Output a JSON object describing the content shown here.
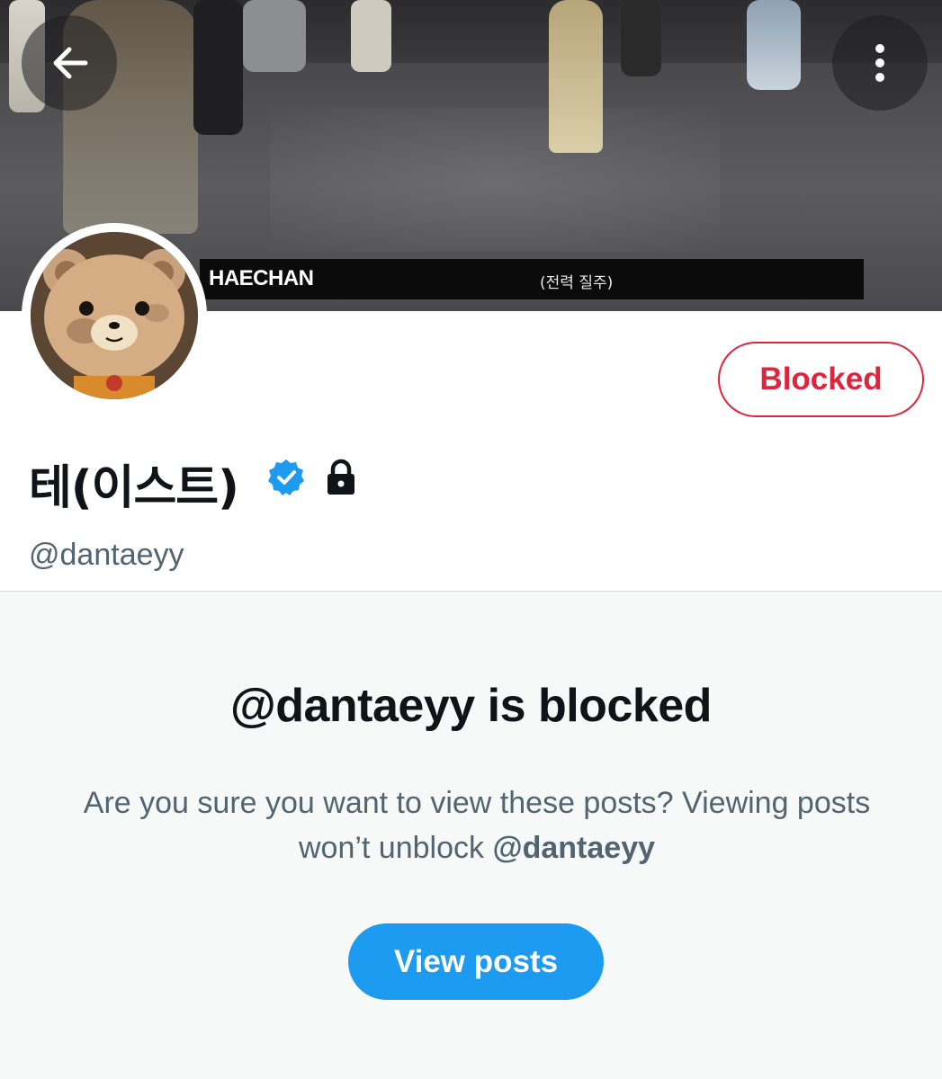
{
  "header": {
    "back_icon": "arrow-left-icon",
    "more_icon": "vertical-dots-icon",
    "banner_caption": {
      "name": "HAECHAN",
      "subtitle": "(전력 질주)"
    }
  },
  "profile": {
    "display_name": "테(이스트)",
    "verified_icon": "verified-badge-icon",
    "protected_icon": "lock-icon",
    "handle": "@dantaeyy",
    "blocked_button_label": "Blocked"
  },
  "notice": {
    "title": "@dantaeyy is blocked",
    "body_text": "Are you sure you want to view these posts? Viewing posts won’t unblock ",
    "body_handle": "@dantaeyy",
    "view_posts_label": "View posts"
  },
  "colors": {
    "accent": "#1d9bf0",
    "blocked_red": "#e0243c",
    "text_primary": "#0f1419",
    "text_secondary": "#536471",
    "page_bg": "#f7f9f9"
  }
}
